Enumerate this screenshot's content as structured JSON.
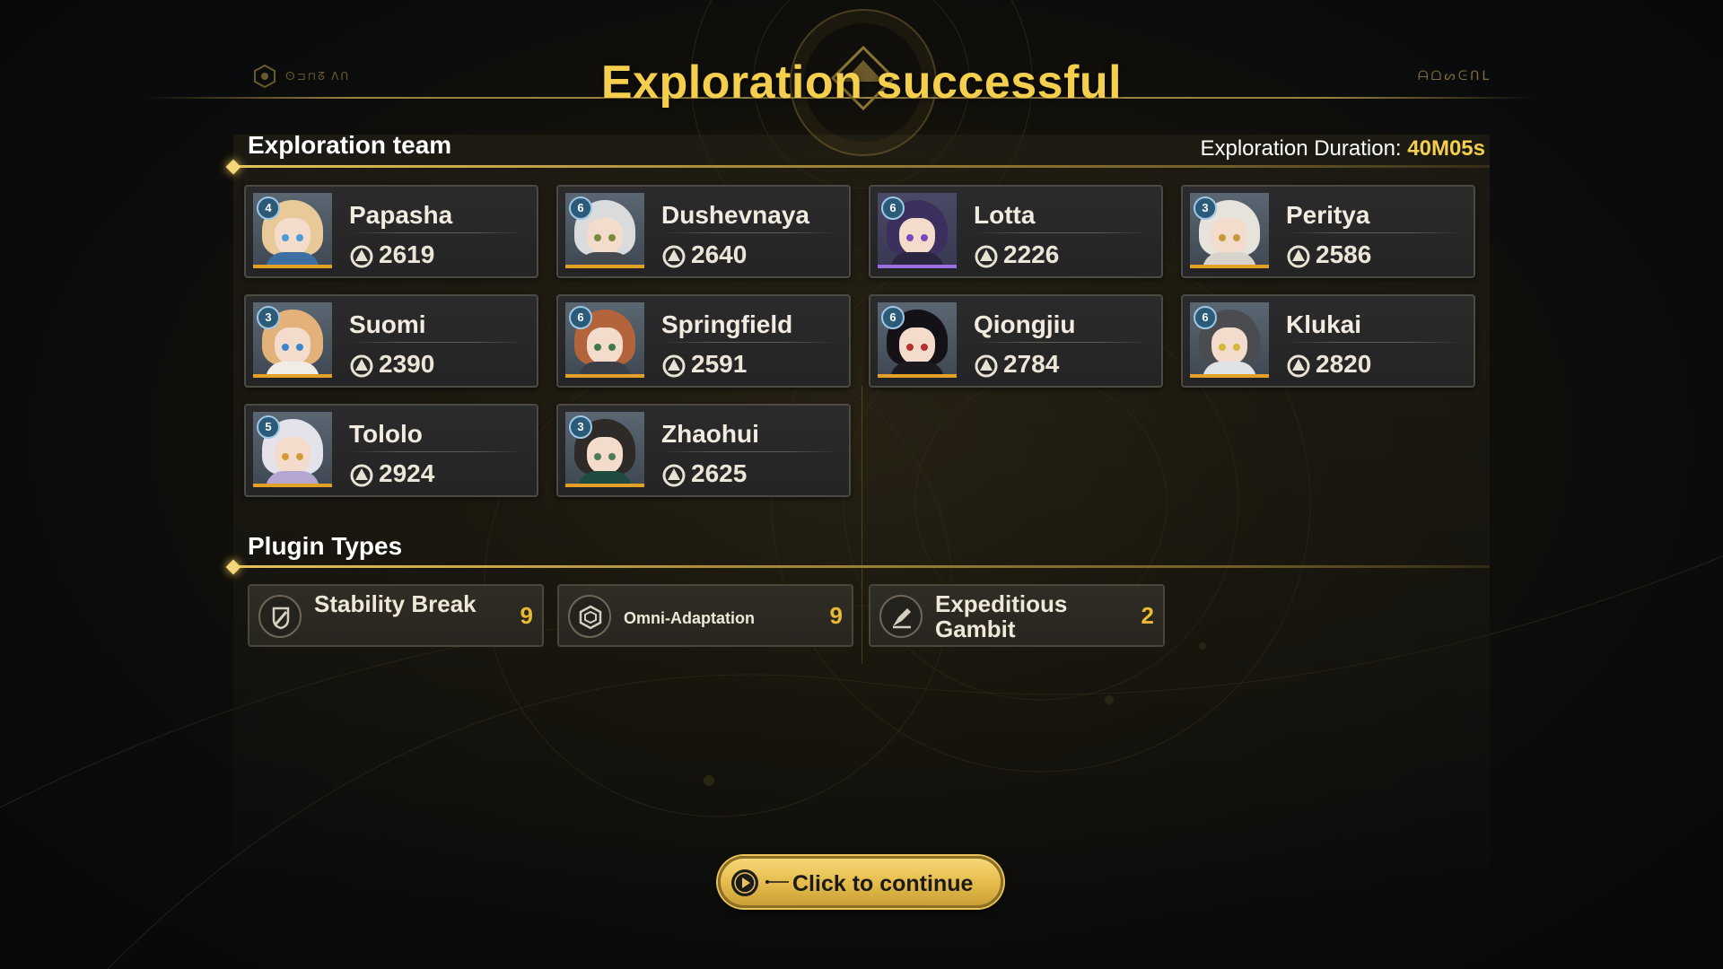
{
  "title": "Exploration successful",
  "brand": {
    "left_logo_text": "ⵙ⊐⊓ᘔ ᐱᑎ",
    "right_logo_text": "ᗩᗝᔕᕮᑎᒪ"
  },
  "team": {
    "heading": "Exploration team",
    "duration_label": "Exploration Duration:",
    "duration_value": "40M05s",
    "members": [
      {
        "name": "Papasha",
        "power": "2619",
        "rank": "4"
      },
      {
        "name": "Dushevnaya",
        "power": "2640",
        "rank": "6"
      },
      {
        "name": "Lotta",
        "power": "2226",
        "rank": "6"
      },
      {
        "name": "Perityа",
        "power": "2586",
        "rank": "3"
      },
      {
        "name": "Suomi",
        "power": "2390",
        "rank": "3"
      },
      {
        "name": "Springfield",
        "power": "2591",
        "rank": "6"
      },
      {
        "name": "Qiongjiu",
        "power": "2784",
        "rank": "6"
      },
      {
        "name": "Klukai",
        "power": "2820",
        "rank": "6"
      },
      {
        "name": "Tololo",
        "power": "2924",
        "rank": "5"
      },
      {
        "name": "Zhaohui",
        "power": "2625",
        "rank": "3"
      }
    ]
  },
  "plugins": {
    "heading": "Plugin Types",
    "items": [
      {
        "name": "Stability Break",
        "count": "9",
        "icon": "stability-break-icon"
      },
      {
        "name": "Omni-Adaptation",
        "count": "9",
        "icon": "omni-adaptation-icon"
      },
      {
        "name": "Expeditious Gambit",
        "count": "2",
        "icon": "expeditious-gambit-icon"
      }
    ]
  },
  "continue_button": {
    "label": "Click to continue"
  },
  "colors": {
    "accent_gold": "#f4cf4d",
    "count_gold": "#e9b934",
    "rarity_bar": "#e3a128",
    "rarity_bar_alt": "#9a6ee0"
  }
}
